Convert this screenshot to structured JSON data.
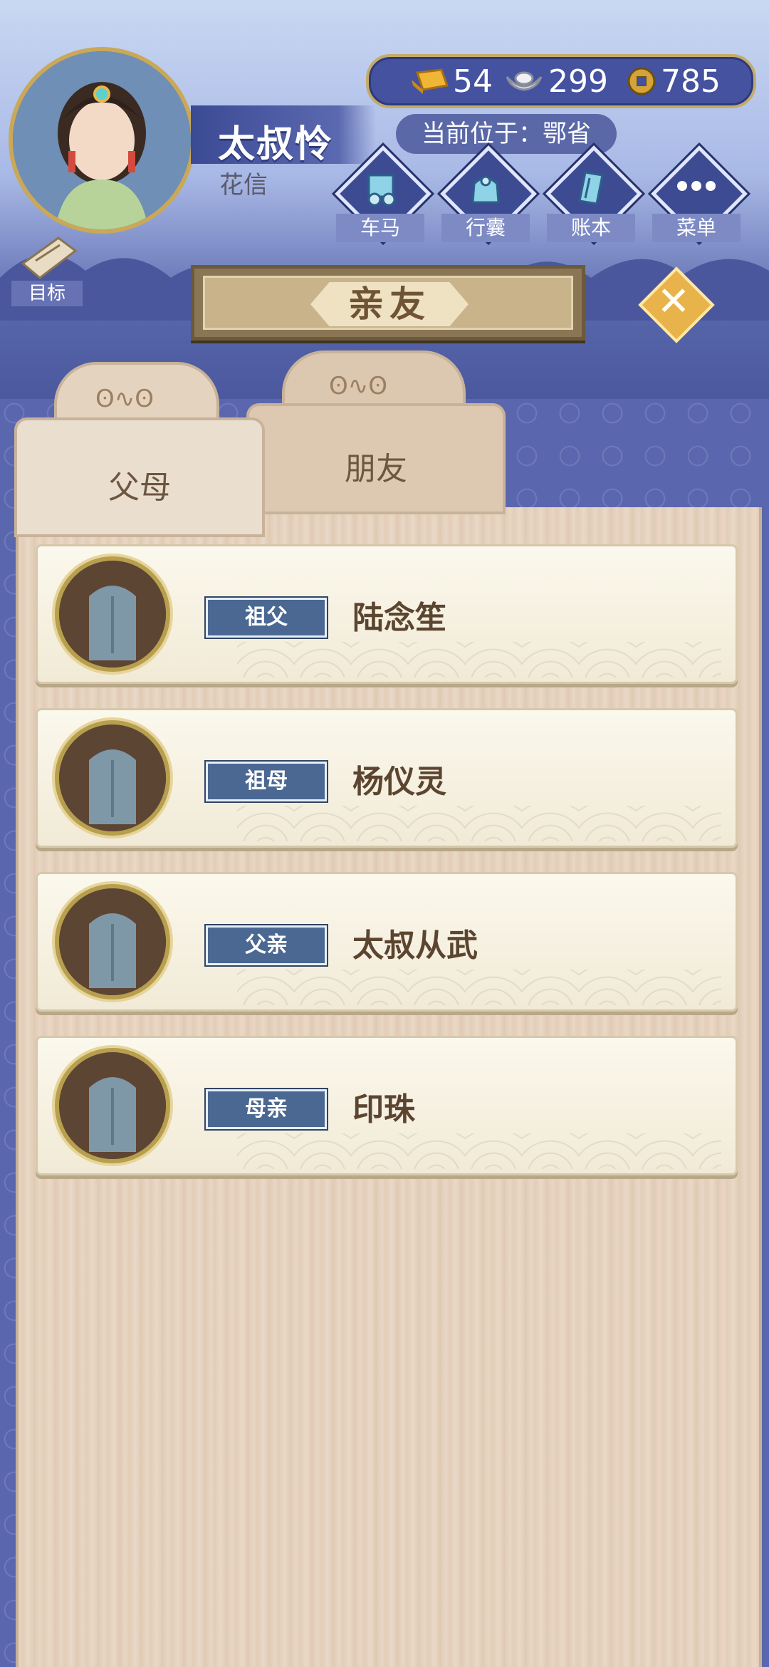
{
  "header": {
    "character_name": "太叔怜",
    "character_title": "花信",
    "location": "当前位于：鄂省",
    "resources": [
      {
        "icon": "gold-bar-icon",
        "value": "54"
      },
      {
        "icon": "silver-ingot-icon",
        "value": "299"
      },
      {
        "icon": "copper-coin-icon",
        "value": "785"
      }
    ],
    "nav": [
      {
        "icon": "carriage-icon",
        "label": "车马"
      },
      {
        "icon": "bag-icon",
        "label": "行囊"
      },
      {
        "icon": "ledger-icon",
        "label": "账本"
      },
      {
        "icon": "more-icon",
        "label": "菜单"
      }
    ],
    "goal_label": "目标"
  },
  "panel": {
    "title": "亲友",
    "tabs": [
      {
        "label": "父母",
        "active": true
      },
      {
        "label": "朋友",
        "active": false
      }
    ]
  },
  "relatives": [
    {
      "relation": "祖父",
      "name": "陆念笙"
    },
    {
      "relation": "祖母",
      "name": "杨仪灵"
    },
    {
      "relation": "父亲",
      "name": "太叔从武"
    },
    {
      "relation": "母亲",
      "name": "印珠"
    }
  ],
  "colors": {
    "accent_blue": "#4552a0",
    "gold": "#c5ab6a",
    "wood": "#e8d6c4",
    "relation_tag": "#4a6892"
  }
}
